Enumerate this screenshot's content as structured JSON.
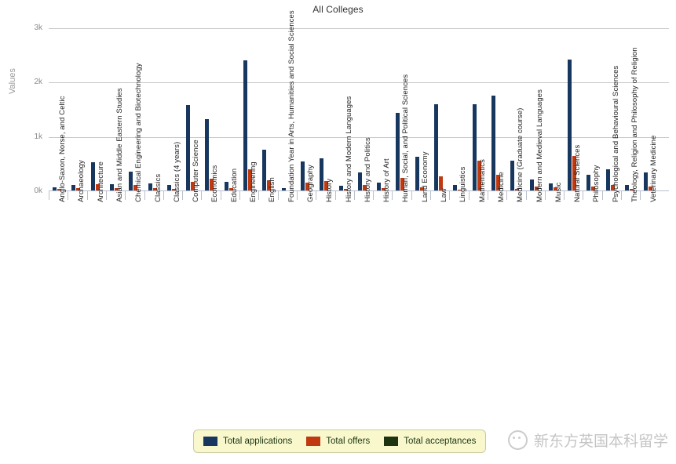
{
  "chart_data": {
    "type": "bar",
    "title": "All Colleges",
    "xlabel": "",
    "ylabel": "Values",
    "ylim": [
      0,
      3000
    ],
    "yticks": [
      0,
      1000,
      2000,
      3000
    ],
    "ytick_labels": [
      "0k",
      "1k",
      "2k",
      "3k"
    ],
    "grid": true,
    "legend_position": "bottom-center",
    "categories": [
      "Anglo-Saxon, Norse, and Celtic",
      "Archaeology",
      "Architecture",
      "Asian and Middle Eastern Studies",
      "Chemical Engineering and Biotechnology",
      "Classics",
      "Classics (4 years)",
      "Computer Science",
      "Economics",
      "Education",
      "Engineering",
      "English",
      "Foundation Year in Arts, Humanities and Social Sciences",
      "Geography",
      "History",
      "History and Modern Languages",
      "History and Politics",
      "History of Art",
      "Human, Social, and Political Sciences",
      "Land Economy",
      "Law",
      "Linguistics",
      "Mathematics",
      "Medicine",
      "Medicine (Graduate course)",
      "Modern and Medieval Languages",
      "Music",
      "Natural Sciences",
      "Philosophy",
      "Psychological and Behavioural Sciences",
      "Theology, Religion and Philosophy of Religion",
      "Veterinary Medicine"
    ],
    "series": [
      {
        "name": "Total applications",
        "color": "#17375e",
        "values": [
          70,
          110,
          540,
          130,
          360,
          140,
          110,
          1590,
          1330,
          180,
          2410,
          760,
          60,
          550,
          600,
          100,
          350,
          160,
          1440,
          640,
          1600,
          120,
          1600,
          1760,
          560,
          220,
          150,
          2430,
          300,
          400,
          110,
          340
        ]
      },
      {
        "name": "Total offers",
        "color": "#c0390f",
        "values": [
          40,
          55,
          130,
          60,
          115,
          55,
          45,
          170,
          230,
          60,
          400,
          200,
          20,
          155,
          190,
          40,
          110,
          60,
          240,
          75,
          280,
          30,
          560,
          310,
          40,
          90,
          70,
          650,
          90,
          110,
          45,
          90
        ]
      },
      {
        "name": "Total acceptances",
        "color": "#1c3510",
        "values": [
          0,
          0,
          0,
          0,
          0,
          0,
          0,
          0,
          0,
          0,
          0,
          0,
          0,
          0,
          0,
          0,
          0,
          0,
          0,
          0,
          0,
          0,
          0,
          0,
          0,
          0,
          0,
          0,
          0,
          0,
          0,
          0
        ]
      }
    ]
  },
  "legend": {
    "items": [
      {
        "label": "Total applications",
        "color": "#17375e"
      },
      {
        "label": "Total offers",
        "color": "#c0390f"
      },
      {
        "label": "Total acceptances",
        "color": "#1c3510"
      }
    ]
  },
  "watermark": {
    "text": "新东方英国本科留学",
    "logo": "wechat-smiley-icon"
  }
}
